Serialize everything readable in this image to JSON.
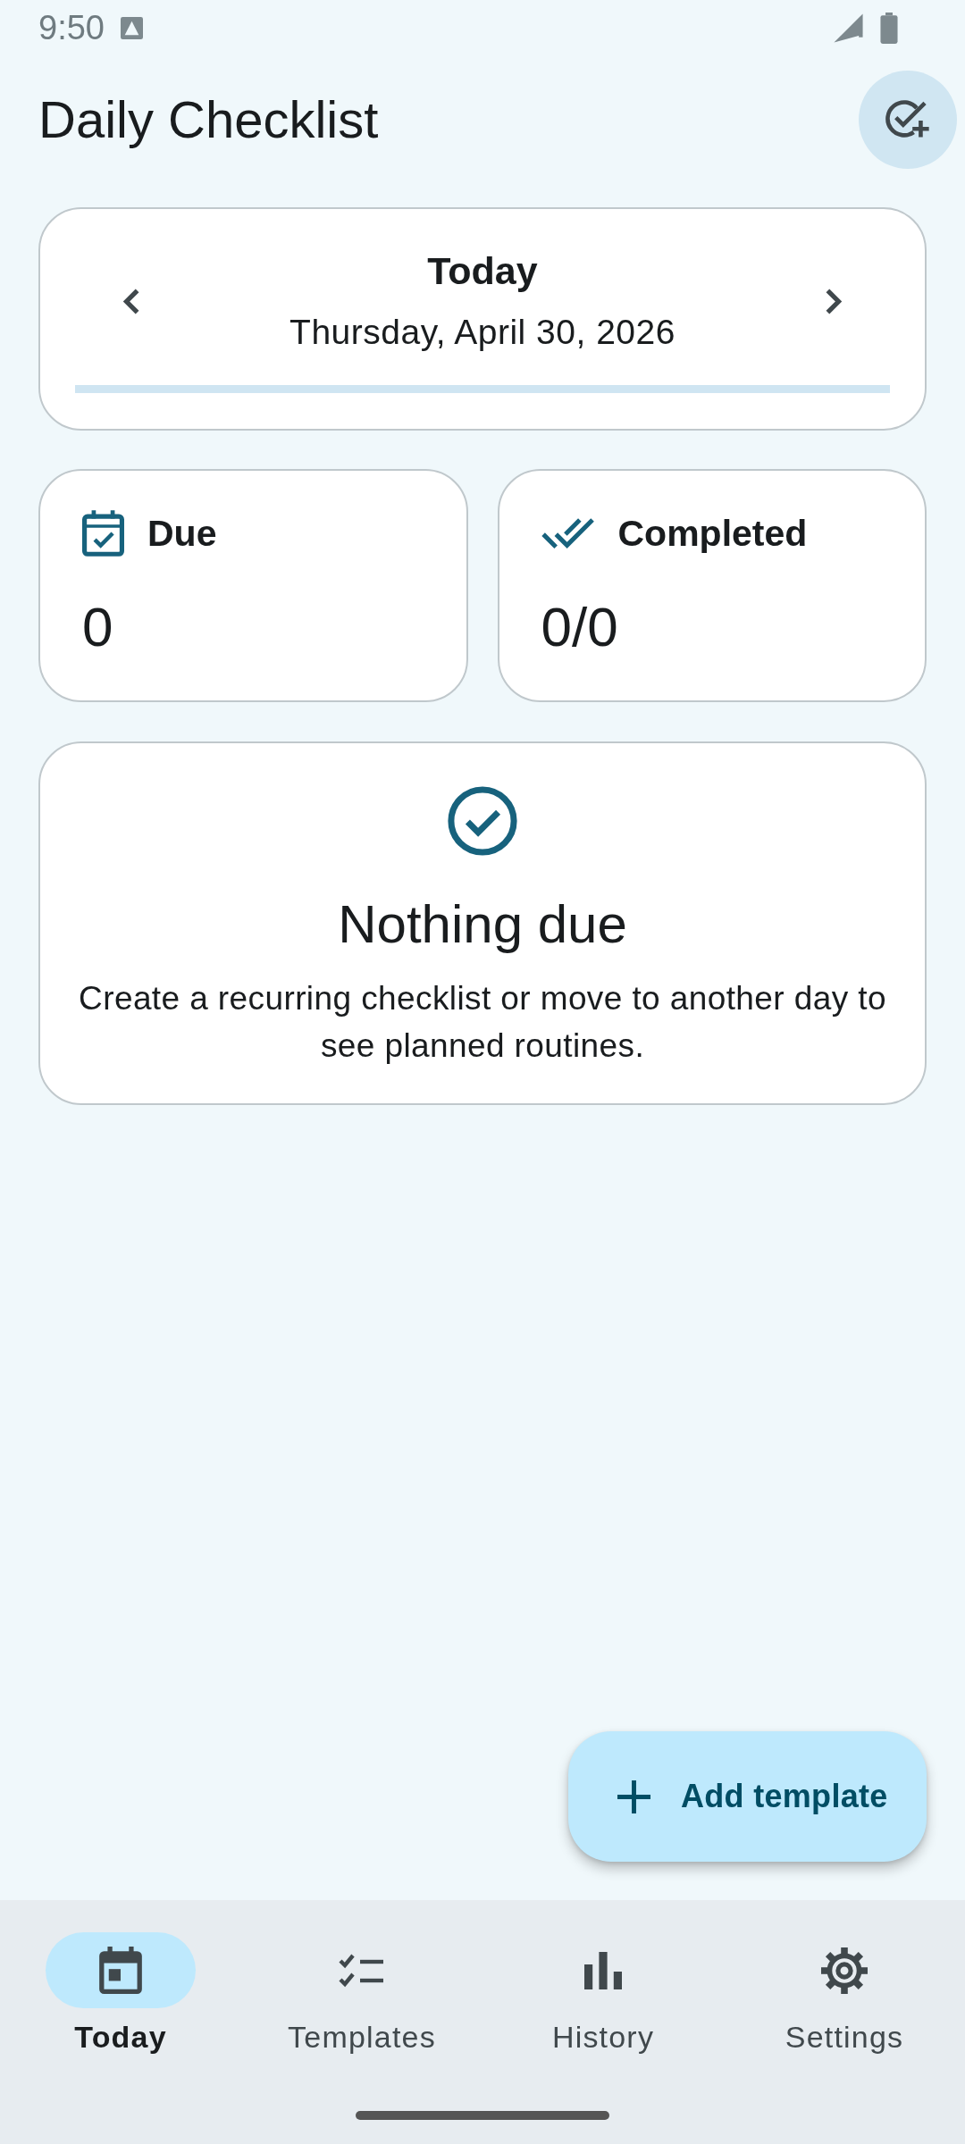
{
  "status_bar": {
    "time": "9:50"
  },
  "app_bar": {
    "title": "Daily Checklist"
  },
  "date_card": {
    "title": "Today",
    "date": "Thursday, April 30, 2026",
    "progress": {
      "level": 0
    }
  },
  "stats": [
    {
      "kind": "due",
      "label": "Due",
      "value": "0"
    },
    {
      "kind": "completed",
      "label": "Completed",
      "value": "0/0"
    }
  ],
  "empty_state": {
    "title": "Nothing due",
    "message": "Create a recurring checklist or move to another day to see planned routines."
  },
  "fab": {
    "label": "Add template"
  },
  "nav": [
    {
      "kind": "today",
      "label": "Today",
      "selected": true
    },
    {
      "kind": "templates",
      "label": "Templates",
      "selected": false
    },
    {
      "kind": "history",
      "label": "History",
      "selected": false
    },
    {
      "kind": "settings",
      "label": "Settings",
      "selected": false
    }
  ]
}
